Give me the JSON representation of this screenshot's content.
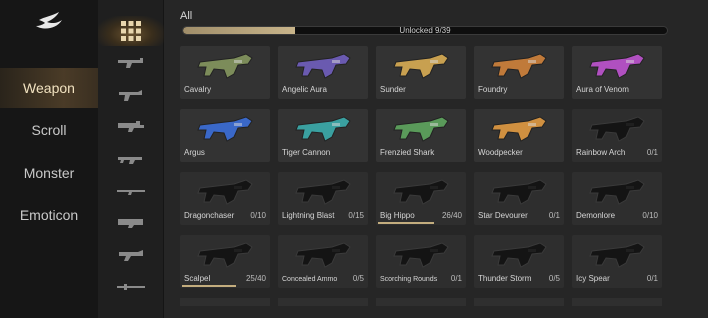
{
  "categories": [
    {
      "label": "Weapon",
      "active": true
    },
    {
      "label": "Scroll",
      "active": false
    },
    {
      "label": "Monster",
      "active": false
    },
    {
      "label": "Emoticon",
      "active": false
    }
  ],
  "filter": {
    "label": "All"
  },
  "progress": {
    "text": "Unlocked 9/39",
    "unlocked": 9,
    "total": 39
  },
  "cards": [
    {
      "name": "Cavalry",
      "count": "",
      "unlocked": true,
      "color": "#7c8c5a"
    },
    {
      "name": "Angelic Aura",
      "count": "",
      "unlocked": true,
      "color": "#6a5ab0"
    },
    {
      "name": "Sunder",
      "count": "",
      "unlocked": true,
      "color": "#c8a050"
    },
    {
      "name": "Foundry",
      "count": "",
      "unlocked": true,
      "color": "#c07a3a"
    },
    {
      "name": "Aura of Venom",
      "count": "",
      "unlocked": true,
      "color": "#b050c0"
    },
    {
      "name": "Argus",
      "count": "",
      "unlocked": true,
      "color": "#3a68c8"
    },
    {
      "name": "Tiger Cannon",
      "count": "",
      "unlocked": true,
      "color": "#3aa0a0"
    },
    {
      "name": "Frenzied Shark",
      "count": "",
      "unlocked": true,
      "color": "#5a9a5a"
    },
    {
      "name": "Woodpecker",
      "count": "",
      "unlocked": true,
      "color": "#d09040"
    },
    {
      "name": "Rainbow Arch",
      "count": "0/1",
      "unlocked": false,
      "progress": 0
    },
    {
      "name": "Dragonchaser",
      "count": "0/10",
      "unlocked": false,
      "progress": 0
    },
    {
      "name": "Lightning Blast",
      "count": "0/15",
      "unlocked": false,
      "progress": 0
    },
    {
      "name": "Big Hippo",
      "count": "26/40",
      "unlocked": false,
      "progress": 0.65
    },
    {
      "name": "Star Devourer",
      "count": "0/1",
      "unlocked": false,
      "progress": 0
    },
    {
      "name": "Demonlore",
      "count": "0/10",
      "unlocked": false,
      "progress": 0
    },
    {
      "name": "Scalpel",
      "count": "25/40",
      "unlocked": false,
      "progress": 0.625
    },
    {
      "name": "Concealed Ammo",
      "count": "0/5",
      "unlocked": false,
      "progress": 0,
      "small": true
    },
    {
      "name": "Scorching Rounds",
      "count": "0/1",
      "unlocked": false,
      "progress": 0,
      "small": true
    },
    {
      "name": "Thunder Storm",
      "count": "0/5",
      "unlocked": false,
      "progress": 0
    },
    {
      "name": "Icy Spear",
      "count": "0/1",
      "unlocked": false,
      "progress": 0
    }
  ],
  "sub_icons": [
    "grid-all-icon",
    "gun-type-1-icon",
    "gun-type-2-icon",
    "gun-type-3-icon",
    "gun-type-4-icon",
    "gun-type-5-icon",
    "gun-type-6-icon",
    "gun-type-7-icon",
    "gun-type-8-icon"
  ],
  "colors": {
    "accent": "#c8b48a",
    "active_category": "#4a3b27"
  }
}
